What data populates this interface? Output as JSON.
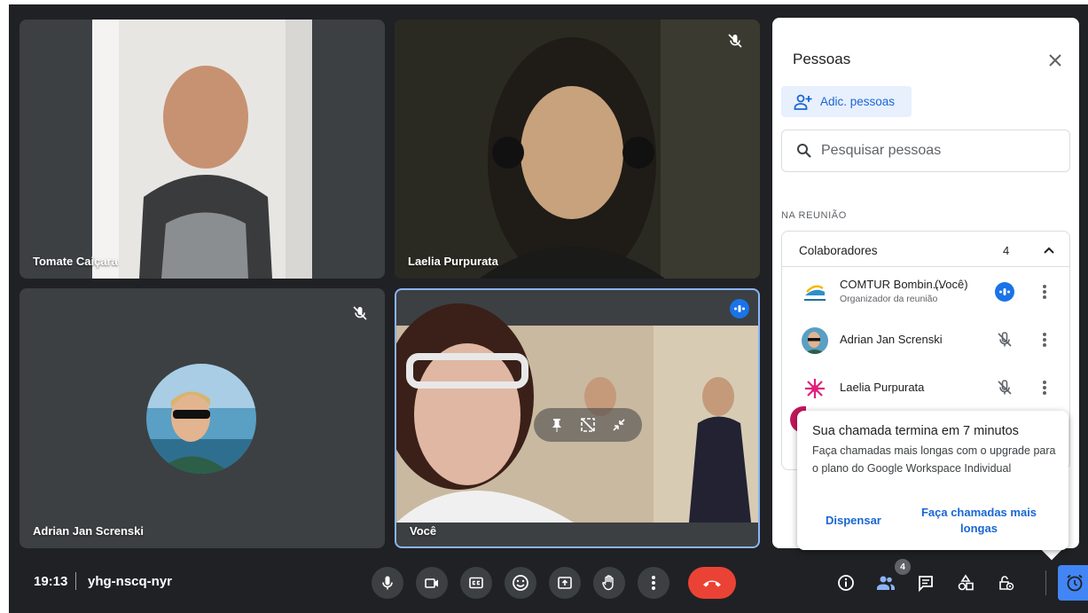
{
  "tiles": [
    {
      "name": "Tomate Caiçara"
    },
    {
      "name": "Laelia Purpurata"
    },
    {
      "name": "Adrian Jan Screnski"
    },
    {
      "name": "Você"
    }
  ],
  "panel": {
    "title": "Pessoas",
    "add_label": "Adic. pessoas",
    "search_placeholder": "Pesquisar pessoas",
    "section_label": "NA REUNIÃO",
    "group_title": "Colaboradores",
    "group_count": "4",
    "people": [
      {
        "name": "COMTUR Bombin...",
        "suffix": "(Você)",
        "role": "Organizador da reunião",
        "state": "speaking"
      },
      {
        "name": "Adrian Jan Screnski",
        "state": "muted"
      },
      {
        "name": "Laelia Purpurata",
        "state": "muted"
      }
    ]
  },
  "popup": {
    "title": "Sua chamada termina em 7 minutos",
    "body": "Faça chamadas mais longas com o upgrade para o plano do Google Workspace Individual",
    "dismiss": "Dispensar",
    "upgrade": "Faça chamadas mais longas"
  },
  "bottom_bar": {
    "time": "19:13",
    "meeting_code": "yhg-nscq-nyr",
    "people_badge": "4",
    "controls": [
      "mic-icon",
      "camera-icon",
      "captions-icon",
      "emoji-icon",
      "present-icon",
      "raise-hand-icon",
      "more-options-icon",
      "end-call-icon"
    ],
    "right_controls": [
      "info-icon",
      "people-icon",
      "chat-icon",
      "activities-icon",
      "host-controls-icon",
      "timer-icon"
    ]
  },
  "colors": {
    "background": "#202124",
    "tile": "#3c4043",
    "accent": "#1a73e8",
    "end_call": "#ea4335"
  }
}
